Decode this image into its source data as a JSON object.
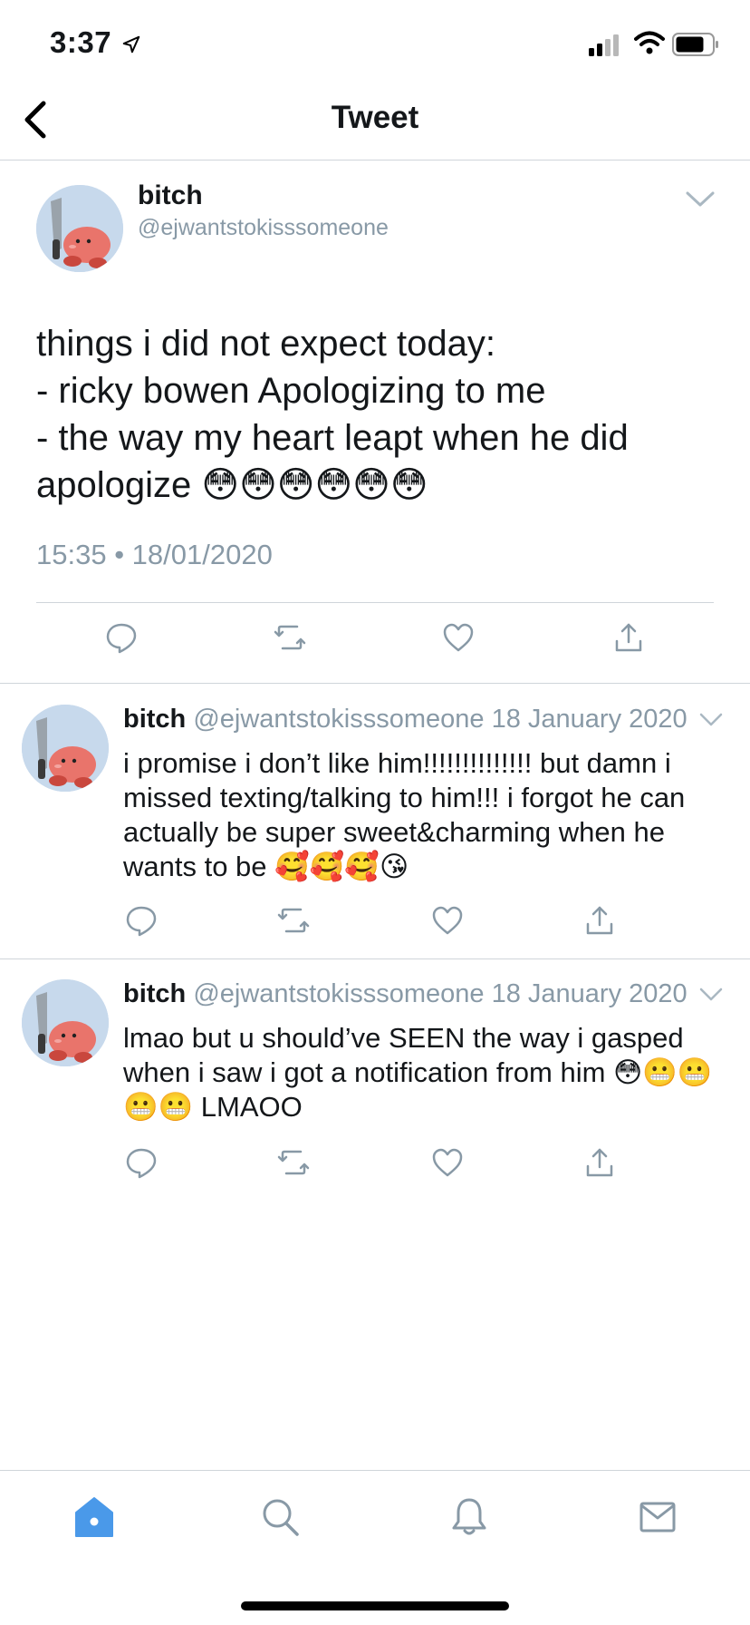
{
  "status_bar": {
    "time": "3:37",
    "icons": [
      "location-arrow-icon",
      "signal-icon",
      "wifi-icon",
      "battery-icon"
    ]
  },
  "nav": {
    "title": "Tweet",
    "back_icon": "chevron-left-icon"
  },
  "main_tweet": {
    "display_name": "bitch",
    "handle": "@ejwantstokisssomeone",
    "text": "things i did not expect today:\n- ricky bowen Apologizing to me\n- the way my heart leapt when he did apologize 😳😳😳😳😳😳",
    "timestamp": "15:35 • 18/01/2020",
    "actions": [
      "reply-icon",
      "retweet-icon",
      "like-icon",
      "share-icon"
    ]
  },
  "replies": [
    {
      "display_name": "bitch",
      "handle": "@ejwantstokisssomeone",
      "date": "18 January 2020",
      "text": "i promise i don’t like him!!!!!!!!!!!!!! but damn i missed texting/talking to him!!! i forgot he can actually be super sweet&charming when he wants to be 🥰🥰🥰😘"
    },
    {
      "display_name": "bitch",
      "handle": "@ejwantstokisssomeone",
      "date": "18 January 2020",
      "text": "lmao but u should’ve SEEN the way i gasped when i saw i got a notification from him 😳😬😬😬😬 LMAOO"
    }
  ],
  "tab_bar": {
    "items": [
      "home-icon",
      "search-icon",
      "notifications-icon",
      "messages-icon"
    ],
    "active": "home-icon",
    "accent_color": "#4a99e9"
  },
  "colors": {
    "text": "#14171a",
    "secondary_text": "#8899a6",
    "divider": "#cfd5da"
  }
}
